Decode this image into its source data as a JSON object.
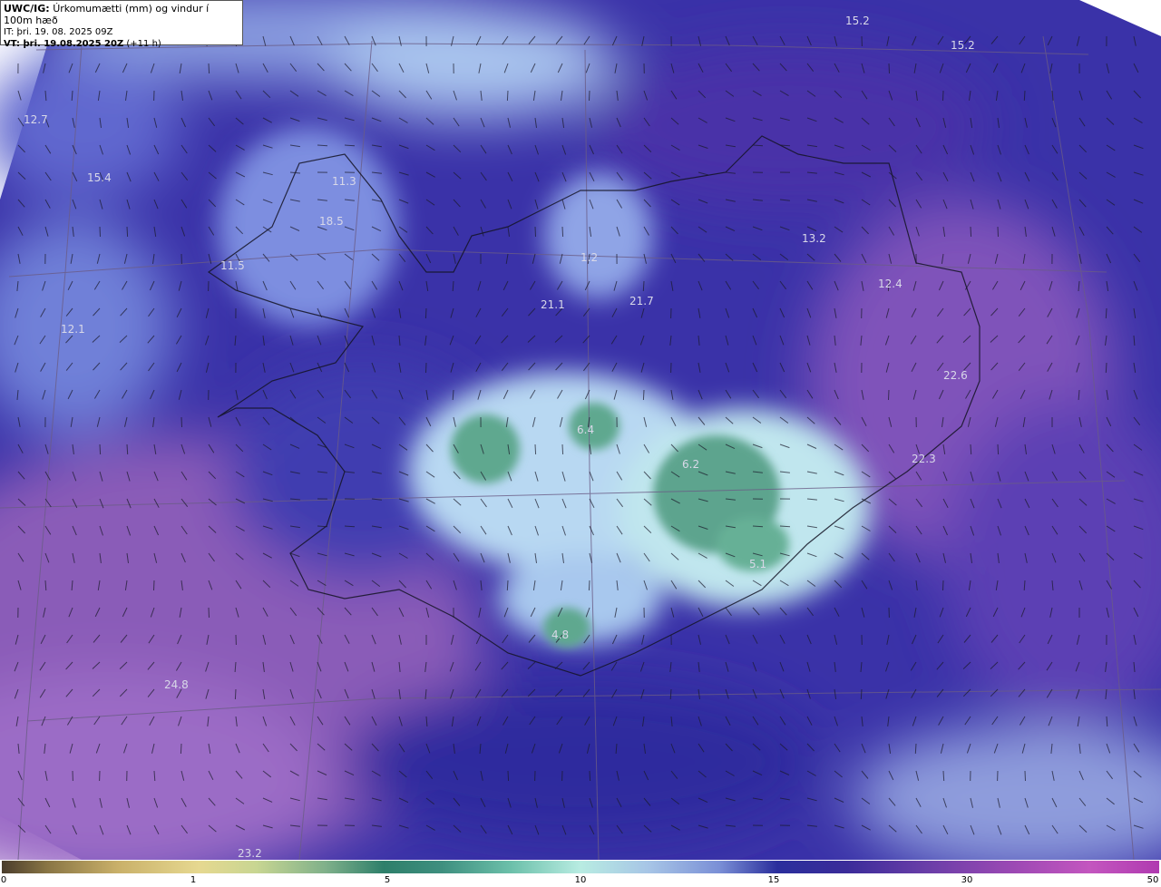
{
  "header": {
    "model": "UWC/IG:",
    "title": "Úrkomumætti (mm) og vindur í 100m hæð",
    "issue_time": "IT: þri. 19. 08. 2025 09Z",
    "valid_prefix": "VT: þri. 19.08.2025 20Z",
    "valid_offset": "(+11 h)"
  },
  "map_values": [
    "15.2",
    "15.2",
    "12.7",
    "15.4",
    "11.3",
    "18.5",
    "11.5",
    "12.1",
    "1.2",
    "21.1",
    "21.7",
    "13.2",
    "12.4",
    "22.6",
    "22.3",
    "6.4",
    "6.2",
    "5.1",
    "4.8",
    "24.8",
    "23.2"
  ],
  "colorbar": {
    "ticks": [
      "0",
      "1",
      "5",
      "10",
      "15",
      "30",
      "50"
    ],
    "colors": [
      "#4a3d2c",
      "#c9b069",
      "#2e7f6a",
      "#b8ece2",
      "#2a2e9c",
      "#a04ab5",
      "#b03ab0"
    ]
  }
}
